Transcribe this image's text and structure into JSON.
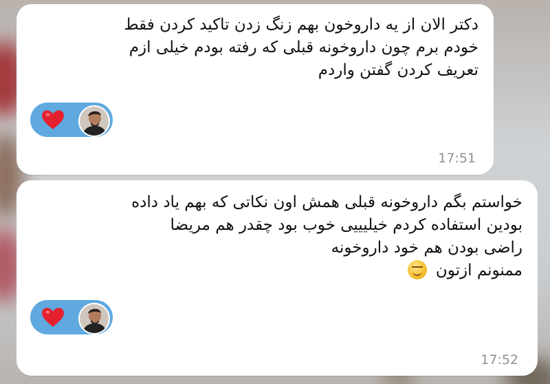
{
  "messages": [
    {
      "text": "دکتر الان از یه داروخون بهم زنگ زدن تاکید کردن فقط\nخودم برم چون داروخونه قبلی که رفته بودم خیلی ازم\nتعریف کردن گفتن واردم",
      "time": "17:51",
      "reaction": {
        "emoji": "heart-icon",
        "color": "#e5212f"
      }
    },
    {
      "text": "خواستم بگم داروخونه قبلی همش اون نکاتی که بهم یاد داده\nبودین استفاده کردم خیلیییی خوب بود چقدر هم مریضا\nراضی بودن هم خود داروخونه\nممنونم ازتون",
      "emoji": "smiling-blush-emoji",
      "time": "17:52",
      "reaction": {
        "emoji": "heart-icon",
        "color": "#e5212f"
      }
    }
  ],
  "colors": {
    "bubble": "#ffffff",
    "reaction_pill": "#5fa9e0",
    "timestamp": "#8c9196"
  }
}
